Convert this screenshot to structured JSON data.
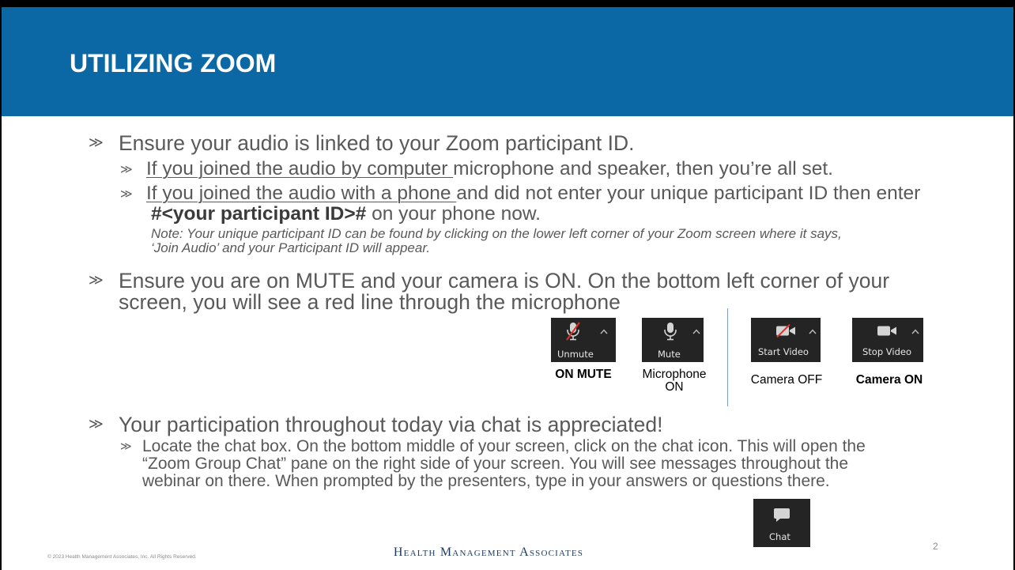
{
  "slide": {
    "title": "UTILIZING ZOOM",
    "bullet_glyph": "≫",
    "brand": "Health Management Associates",
    "copyright": "© 2023 Health Management Associates, Inc. All Rights Reserved.",
    "page_number": "2"
  },
  "audio": {
    "heading": "Ensure your audio is linked to your Zoom participant ID.",
    "computer": {
      "underlined": "If you joined the audio by computer ",
      "rest": "microphone and speaker, then you’re all set."
    },
    "phone": {
      "underlined": "If you joined the audio with a phone ",
      "rest": "and did not enter your unique participant ID then enter",
      "code": "#<your participant ID>#",
      "code_suffix": " on your phone now."
    },
    "note": [
      "Note: Your unique participant ID can be found by clicking on the lower left corner of your Zoom screen where it says,",
      "‘Join Audio’ and your Participant ID will appear."
    ]
  },
  "mute": {
    "lines": [
      "Ensure you are on MUTE and your camera is ON. On the bottom left corner of your",
      "screen, you will see a red line through the microphone"
    ]
  },
  "zoom_buttons": {
    "unmute": {
      "label": "Unmute",
      "caption": "ON MUTE",
      "icon": "microphone-muted-icon"
    },
    "mute": {
      "label": "Mute",
      "caption": [
        "Microphone",
        "ON"
      ],
      "icon": "microphone-icon"
    },
    "start_video": {
      "label": "Start Video",
      "caption": "Camera OFF",
      "icon": "video-off-icon"
    },
    "stop_video": {
      "label": "Stop Video",
      "caption": "Camera ON",
      "icon": "video-icon"
    },
    "chat": {
      "label": "Chat",
      "icon": "chat-icon"
    }
  },
  "chat": {
    "heading": "Your participation throughout today via chat is appreciated!",
    "lines": [
      "Locate the chat box. On the bottom middle of your screen, click on the chat icon. This will open the",
      "“Zoom Group Chat” pane on the right side of your screen. You will see messages throughout the",
      "webinar on there. When prompted by the presenters, type in your answers or questions there."
    ]
  },
  "colors": {
    "header_bg": "#0b68a4",
    "body_text": "#595959",
    "button_bg": "#242424",
    "slash_red": "#e0302c",
    "brand_text": "#1d3a5c"
  }
}
